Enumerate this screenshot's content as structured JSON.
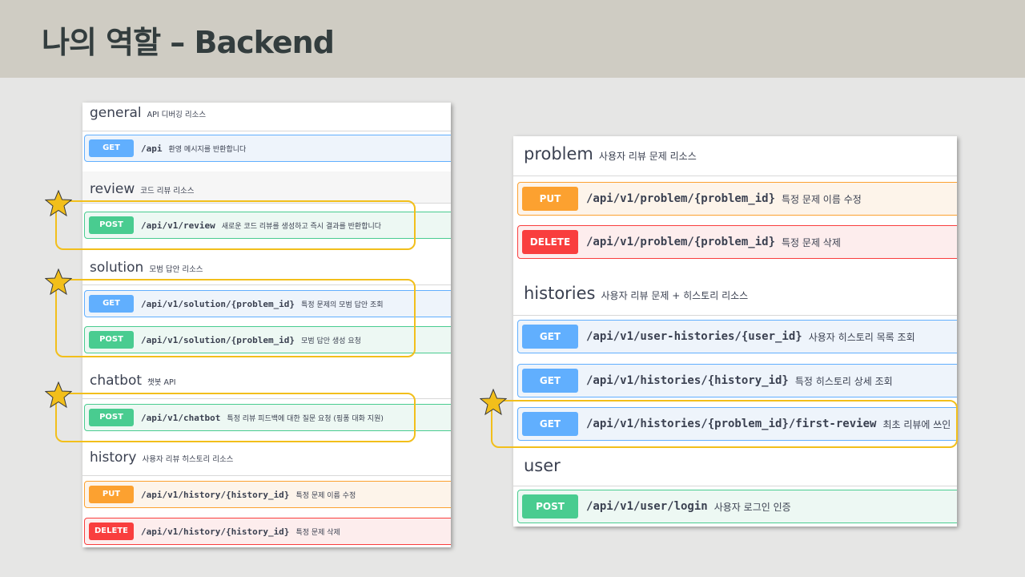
{
  "slide": {
    "title": "나의 역할 – Backend"
  },
  "colors": {
    "highlight": "#f2bf1b",
    "get": "#61affe",
    "post": "#49cc90",
    "put": "#fca130",
    "delete": "#f93e3e"
  },
  "left": {
    "general": {
      "name": "general",
      "desc": "API 디버깅 리소스",
      "ops": [
        {
          "method": "GET",
          "path": "/api",
          "desc": "환영 메시지를 반환합니다"
        }
      ]
    },
    "review": {
      "name": "review",
      "desc": "코드 리뷰 리소스",
      "ops": [
        {
          "method": "POST",
          "path": "/api/v1/review",
          "desc": "새로운 코드 리뷰를 생성하고 즉시 결과를 반환합니다"
        }
      ]
    },
    "solution": {
      "name": "solution",
      "desc": "모범 답안 리소스",
      "ops": [
        {
          "method": "GET",
          "path": "/api/v1/solution/{problem_id}",
          "desc": "특정 문제의 모범 답안 조회"
        },
        {
          "method": "POST",
          "path": "/api/v1/solution/{problem_id}",
          "desc": "모범 답안 생성 요청"
        }
      ]
    },
    "chatbot": {
      "name": "chatbot",
      "desc": "챗봇 API",
      "ops": [
        {
          "method": "POST",
          "path": "/api/v1/chatbot",
          "desc": "특정 리뷰 피드백에 대한 질문 요청 (핑퐁 대화 지원)"
        }
      ]
    },
    "history": {
      "name": "history",
      "desc": "사용자 리뷰 히스토리 리소스",
      "ops": [
        {
          "method": "PUT",
          "path": "/api/v1/history/{history_id}",
          "desc": "특정 문제 이름 수정"
        },
        {
          "method": "DELETE",
          "path": "/api/v1/history/{history_id}",
          "desc": "특정 문제 삭제"
        }
      ]
    }
  },
  "right": {
    "problem": {
      "name": "problem",
      "desc": "사용자 리뷰 문제 리소스",
      "ops": [
        {
          "method": "PUT",
          "path": "/api/v1/problem/{problem_id}",
          "desc": "특정 문제 이름 수정"
        },
        {
          "method": "DELETE",
          "path": "/api/v1/problem/{problem_id}",
          "desc": "특정 문제 삭제"
        }
      ]
    },
    "histories": {
      "name": "histories",
      "desc": "사용자 리뷰 문제 + 히스토리 리소스",
      "ops": [
        {
          "method": "GET",
          "path": "/api/v1/user-histories/{user_id}",
          "desc": "사용자 히스토리 목록 조회"
        },
        {
          "method": "GET",
          "path": "/api/v1/histories/{history_id}",
          "desc": "특정 히스토리 상세 조회"
        },
        {
          "method": "GET",
          "path": "/api/v1/histories/{problem_id}/first-review",
          "desc": "최초 리뷰에 쓰인"
        }
      ]
    },
    "user": {
      "name": "user",
      "desc": "",
      "ops": [
        {
          "method": "POST",
          "path": "/api/v1/user/login",
          "desc": "사용자 로그인 인증"
        }
      ]
    }
  }
}
